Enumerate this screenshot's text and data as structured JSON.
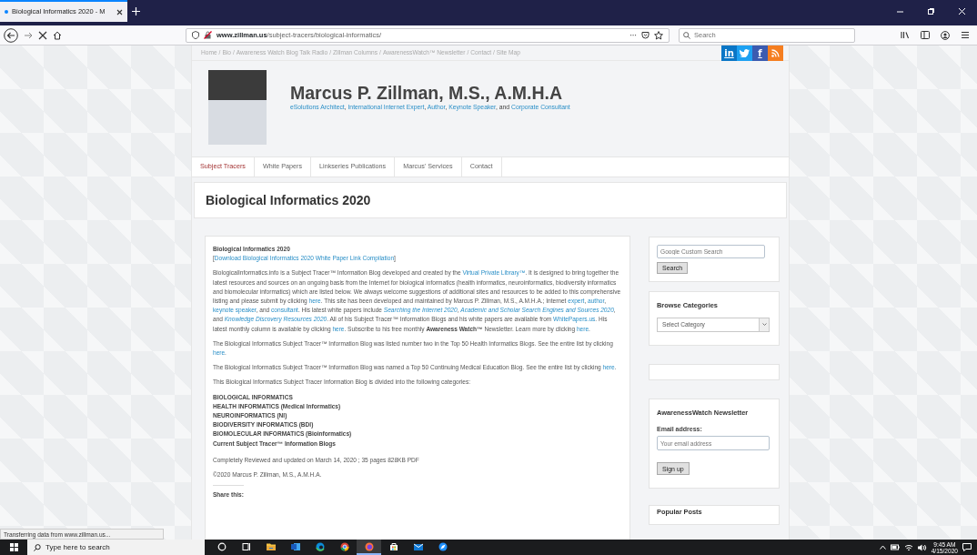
{
  "browser": {
    "tabs": [
      {
        "title": "Biological Informatics 2020 - M",
        "selected": true
      }
    ],
    "url": {
      "domain": "www.zillman.us",
      "path": "/subject-tracers/biological-informatics/"
    },
    "page_actions": "···",
    "search": {
      "placeholder": "Search"
    }
  },
  "site": {
    "top_links": [
      "Home",
      "Bio",
      "Awareness Watch Blog Talk Radio",
      "Zillman Columns",
      "AwarenessWatch™ Newsletter",
      "Contact",
      "Site Map"
    ],
    "separator": "/",
    "social": [
      {
        "kind": "linkedin",
        "label": "in",
        "color": "#0a76c6"
      },
      {
        "kind": "twitter",
        "color": "#1da1f2"
      },
      {
        "kind": "facebook",
        "label": "f",
        "color": "#3b5bb0"
      },
      {
        "kind": "rss",
        "color": "#f57e20"
      }
    ],
    "name": "Marcus P. Zillman, M.S., A.M.H.A",
    "tagline": [
      {
        "kind": "link",
        "text": "eSolutions Architect"
      },
      {
        "kind": "plain",
        "text": ", "
      },
      {
        "kind": "link",
        "text": "International Internet Expert"
      },
      {
        "kind": "plain",
        "text": ", "
      },
      {
        "kind": "link",
        "text": "Author"
      },
      {
        "kind": "plain",
        "text": ", "
      },
      {
        "kind": "link",
        "text": "Keynote Speaker"
      },
      {
        "kind": "plain",
        "text": ", and "
      },
      {
        "kind": "link",
        "text": "Corporate Consultant"
      }
    ],
    "nav": [
      {
        "label": "Subject Tracers",
        "selected": true
      },
      {
        "label": "White Papers",
        "selected": false
      },
      {
        "label": "Linkseries Publications",
        "selected": false
      },
      {
        "label": "Marcus' Services",
        "selected": false
      },
      {
        "label": "Contact",
        "selected": false
      }
    ],
    "page_title": "Biological Informatics 2020"
  },
  "post": {
    "heading": "Biological Informatics 2020",
    "download": [
      {
        "kind": "plain",
        "text": "["
      },
      {
        "kind": "link",
        "text": "Download Biological Informatics 2020 White Paper Link Compilation"
      },
      {
        "kind": "plain",
        "text": "]"
      }
    ],
    "paragraphs": [
      [
        {
          "kind": "plain",
          "text": "BiologicalInformatics.info is a Subject Tracer™ Information Blog developed and created by the "
        },
        {
          "kind": "link",
          "text": "Virtual Private Library™"
        },
        {
          "kind": "plain",
          "text": ". It is designed to bring together the latest resources and sources on an ongoing basis from the Internet for biological informatics (health informatics, neuroinformatics, biodiversity informatics and biomolecular informatics) which are listed below. We always welcome suggestions of additional sites and resources to be added to this comprehensive listing and please submit by clicking "
        },
        {
          "kind": "link",
          "text": "here"
        },
        {
          "kind": "plain",
          "text": ". This site has been developed and maintained by Marcus P. Zillman, M.S., A.M.H.A.; Internet "
        },
        {
          "kind": "link",
          "text": "expert"
        },
        {
          "kind": "plain",
          "text": ", "
        },
        {
          "kind": "link",
          "text": "author"
        },
        {
          "kind": "plain",
          "text": ", "
        },
        {
          "kind": "link",
          "text": "keynote speaker"
        },
        {
          "kind": "plain",
          "text": ", and "
        },
        {
          "kind": "link",
          "text": "consultant"
        },
        {
          "kind": "plain",
          "text": ". His latest white papers include "
        },
        {
          "kind": "italic-link",
          "text": "Searching the Internet 2020"
        },
        {
          "kind": "plain",
          "text": ", "
        },
        {
          "kind": "italic-link",
          "text": "Academic and Scholar Search Engines and Sources 2020"
        },
        {
          "kind": "plain",
          "text": ", and "
        },
        {
          "kind": "italic-link",
          "text": "Knowledge Discovery Resources 2020"
        },
        {
          "kind": "plain",
          "text": ". All of his Subject Tracer™ Information Blogs and his white papers are available from "
        },
        {
          "kind": "link",
          "text": "WhitePapers.us"
        },
        {
          "kind": "plain",
          "text": ". His latest monthly column is available by clicking "
        },
        {
          "kind": "link",
          "text": "here"
        },
        {
          "kind": "plain",
          "text": ". Subscribe to his free monthly "
        },
        {
          "kind": "bold",
          "text": "Awareness Watch™"
        },
        {
          "kind": "plain",
          "text": " Newsletter. Learn more by clicking "
        },
        {
          "kind": "link",
          "text": "here"
        },
        {
          "kind": "plain",
          "text": "."
        }
      ],
      [
        {
          "kind": "plain",
          "text": "The Biological Informatics Subject Tracer™ Information Blog was listed number two in the Top 50 Health Informatics Blogs. See the entire list by clicking "
        },
        {
          "kind": "link",
          "text": "here"
        },
        {
          "kind": "plain",
          "text": "."
        }
      ],
      [
        {
          "kind": "plain",
          "text": "The Biological Informatics Subject Tracer™ Information Blog was named a Top 50 Continuing Medical Education Blog. See the entire list by clicking "
        },
        {
          "kind": "link",
          "text": "here"
        },
        {
          "kind": "plain",
          "text": "."
        }
      ],
      [
        {
          "kind": "plain",
          "text": "This Biological Informatics Subject Tracer Information Blog is divided into the following categories:"
        }
      ]
    ],
    "categories": [
      "BIOLOGICAL INFORMATICS",
      "HEALTH INFORMATICS (Medical Informatics)",
      "NEUROINFORMATICS (NI)",
      "BIODIVERSITY INFORMATICS (BDI)",
      "BIOMOLECULAR INFORMATICS (Bioinformatics)",
      "Current Subject Tracer™ Information Blogs"
    ],
    "updated": "Completely Reviewed and updated on March 14, 2020 ; 35 pages 828KB PDF",
    "copyright": "©2020 Marcus P. Zillman, M.S., A.M.H.A.",
    "share_heading": "Share this:"
  },
  "sidebar": {
    "search": {
      "placeholder": "Google Custom Search",
      "button": "Search"
    },
    "categories": {
      "heading": "Browse Categories",
      "select": "Select Category"
    },
    "newsletter": {
      "heading": "AwarenessWatch Newsletter",
      "label": "Email address:",
      "placeholder": "Your email address",
      "button": "Sign up"
    },
    "popular": {
      "heading": "Popular Posts"
    }
  },
  "status": "Transferring data from www.zillman.us...",
  "taskbar": {
    "search": {
      "placeholder": "Type here to search"
    },
    "apps": [
      {
        "kind": "circle",
        "active": false
      },
      {
        "kind": "taskview",
        "active": false
      },
      {
        "kind": "folder",
        "active": false
      },
      {
        "kind": "word",
        "active": false
      },
      {
        "kind": "edge",
        "active": false
      },
      {
        "kind": "chrome",
        "active": false
      },
      {
        "kind": "firefox",
        "active": true
      },
      {
        "kind": "store",
        "active": false
      },
      {
        "kind": "mail",
        "active": false
      },
      {
        "kind": "compass",
        "active": false
      }
    ],
    "time": "9:45 AM",
    "date": "4/15/2020"
  }
}
